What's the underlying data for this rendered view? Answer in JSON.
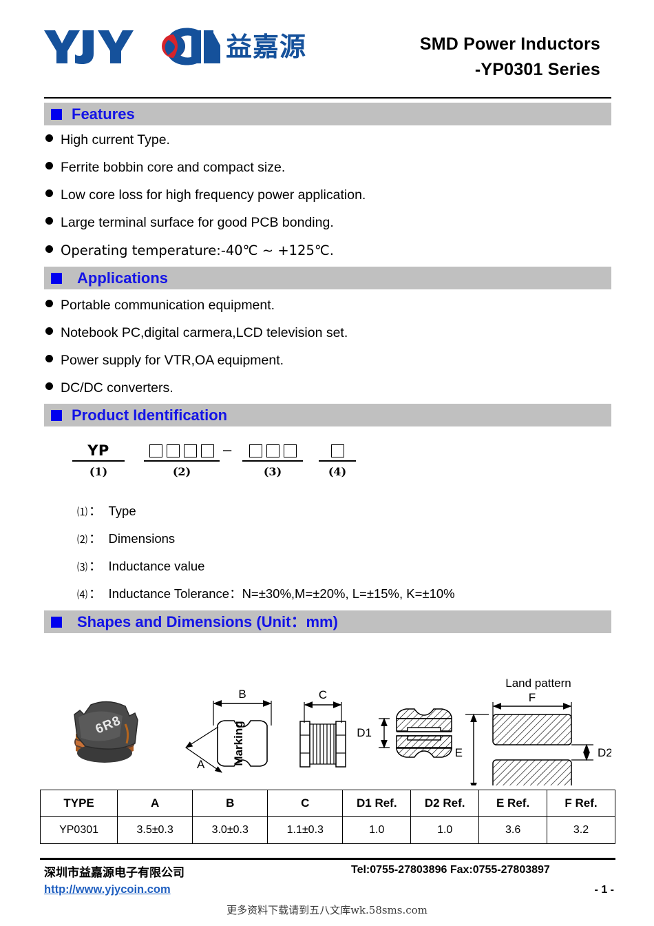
{
  "header": {
    "logo_text": "YJYCOIN",
    "logo_cn": "益嘉源",
    "title_line1": "SMD Power Inductors",
    "title_line2": "-YP0301 Series"
  },
  "sections": {
    "features": {
      "title": "Features",
      "items": [
        "High current Type.",
        "Ferrite bobbin core and compact size.",
        "Low core loss for high frequency power application.",
        "Large terminal surface for good PCB bonding.",
        "Operating temperature:-40℃ ~ +125℃."
      ]
    },
    "applications": {
      "title": "Applications",
      "items": [
        "Portable communication equipment.",
        "Notebook PC,digital carmera,LCD television set.",
        "Power supply for VTR,OA equipment.",
        "DC/DC converters."
      ]
    },
    "product_identification": {
      "title": "Product Identification",
      "diagram": {
        "part1_text": "YP",
        "part1_label": "(1)",
        "part2_boxes": 4,
        "part2_label": "(2)",
        "separator": "–",
        "part3_boxes": 3,
        "part3_label": "(3)",
        "part4_boxes": 1,
        "part4_label": "(4)"
      },
      "legend": [
        {
          "key": "⑴",
          "colon": "：",
          "text": "Type"
        },
        {
          "key": "⑵",
          "colon": "：",
          "text": "Dimensions"
        },
        {
          "key": "⑶",
          "colon": "：",
          "text": "Inductance value"
        },
        {
          "key": "⑷",
          "colon": "：",
          "text": "Inductance Tolerance：N=±30%,M=±20%, L=±15%, K=±10%"
        }
      ]
    },
    "shapes_and_dimensions": {
      "title": "Shapes and Dimensions (Unit：mm)",
      "drawing_labels": {
        "photo_marking": "6R8",
        "dim_a": "A",
        "dim_b": "B",
        "dim_c": "C",
        "dim_d1": "D1",
        "dim_d2": "D2",
        "dim_e": "E",
        "dim_f": "F",
        "face_marking": "Marking",
        "land_pattern": "Land pattern"
      }
    }
  },
  "dimensions_table": {
    "headers": [
      "TYPE",
      "A",
      "B",
      "C",
      "D1 Ref.",
      "D2 Ref.",
      "E Ref.",
      "F Ref."
    ],
    "rows": [
      [
        "YP0301",
        "3.5±0.3",
        "3.0±0.3",
        "1.1±0.3",
        "1.0",
        "1.0",
        "3.6",
        "3.2"
      ]
    ]
  },
  "footer": {
    "company_cn": "深圳市益嘉源电子有限公司",
    "contact": "Tel:0755-27803896   Fax:0755-27803897",
    "url": "http://www.yjycoin.com",
    "page_number": "- 1 -",
    "promo": "更多资料下载请到五八文库wk.58sms.com"
  },
  "colors": {
    "band_bg": "#C0C0C0",
    "band_title": "#1414E6",
    "band_square": "#0000EE",
    "logo_blue": "#15519B",
    "logo_red": "#D7242B",
    "link_blue": "#1F5FC0"
  }
}
